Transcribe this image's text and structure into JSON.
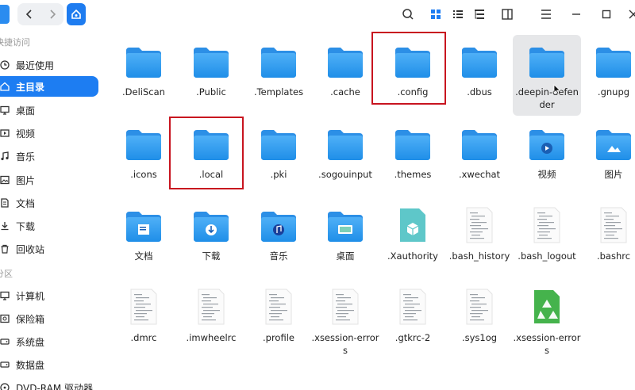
{
  "toolbar": {
    "back_icon": "chevron-left-icon",
    "forward_icon": "chevron-right-icon",
    "home_icon": "home-icon",
    "tools": [
      "search-icon",
      "icon-view-icon",
      "list-view-icon",
      "tree-view-icon",
      "details-panel-icon",
      "menu-icon",
      "minimize-icon",
      "maximize-icon",
      "close-icon"
    ]
  },
  "sidebar": {
    "section_quick": "快捷访问",
    "section_partitions": "分区",
    "items": [
      {
        "label": "最近使用",
        "icon": "clock-icon"
      },
      {
        "label": "主目录",
        "icon": "home-icon"
      },
      {
        "label": "桌面",
        "icon": "desktop-icon"
      },
      {
        "label": "视频",
        "icon": "video-icon"
      },
      {
        "label": "音乐",
        "icon": "music-icon"
      },
      {
        "label": "图片",
        "icon": "picture-icon"
      },
      {
        "label": "文档",
        "icon": "document-icon"
      },
      {
        "label": "下载",
        "icon": "download-icon"
      },
      {
        "label": "回收站",
        "icon": "trash-icon"
      }
    ],
    "devices": [
      {
        "label": "计算机",
        "icon": "computer-icon"
      },
      {
        "label": "保险箱",
        "icon": "safe-icon"
      },
      {
        "label": "系统盘",
        "icon": "disk-icon"
      },
      {
        "label": "数据盘",
        "icon": "disk-icon"
      },
      {
        "label": "DVD-RAM 驱动器",
        "icon": "dvd-icon"
      }
    ]
  },
  "files": [
    {
      "name": ".DeliScan",
      "type": "folder"
    },
    {
      "name": ".Public",
      "type": "folder"
    },
    {
      "name": ".Templates",
      "type": "folder"
    },
    {
      "name": ".cache",
      "type": "folder"
    },
    {
      "name": ".config",
      "type": "folder"
    },
    {
      "name": ".dbus",
      "type": "folder"
    },
    {
      "name": ".deepin-defender",
      "type": "folder"
    },
    {
      "name": ".gnupg",
      "type": "folder"
    },
    {
      "name": ".icons",
      "type": "folder"
    },
    {
      "name": ".local",
      "type": "folder"
    },
    {
      "name": ".pki",
      "type": "folder"
    },
    {
      "name": ".sogouinput",
      "type": "folder"
    },
    {
      "name": ".themes",
      "type": "folder"
    },
    {
      "name": ".xwechat",
      "type": "folder"
    },
    {
      "name": "视频",
      "type": "folder-video"
    },
    {
      "name": "图片",
      "type": "folder-picture"
    },
    {
      "name": "文档",
      "type": "folder-document"
    },
    {
      "name": "下载",
      "type": "folder-download"
    },
    {
      "name": "音乐",
      "type": "folder-music"
    },
    {
      "name": "桌面",
      "type": "folder-desktop"
    },
    {
      "name": ".Xauthority",
      "type": "file-teal"
    },
    {
      "name": ".bash_history",
      "type": "file-text"
    },
    {
      "name": ".bash_logout",
      "type": "file-text"
    },
    {
      "name": ".bashrc",
      "type": "file-text"
    },
    {
      "name": ".dmrc",
      "type": "file-text"
    },
    {
      "name": ".imwheelrc",
      "type": "file-text"
    },
    {
      "name": ".profile",
      "type": "file-text"
    },
    {
      "name": ".xsession-errors",
      "type": "file-text"
    },
    {
      "name": ".gtkrc-2",
      "type": "file-text"
    },
    {
      "name": ".sys1og",
      "type": "file-text"
    },
    {
      "name": ".xsession-errors",
      "type": "file-recycle"
    }
  ],
  "highlight_color": "#c8141f",
  "accent_color": "#1d7df2"
}
